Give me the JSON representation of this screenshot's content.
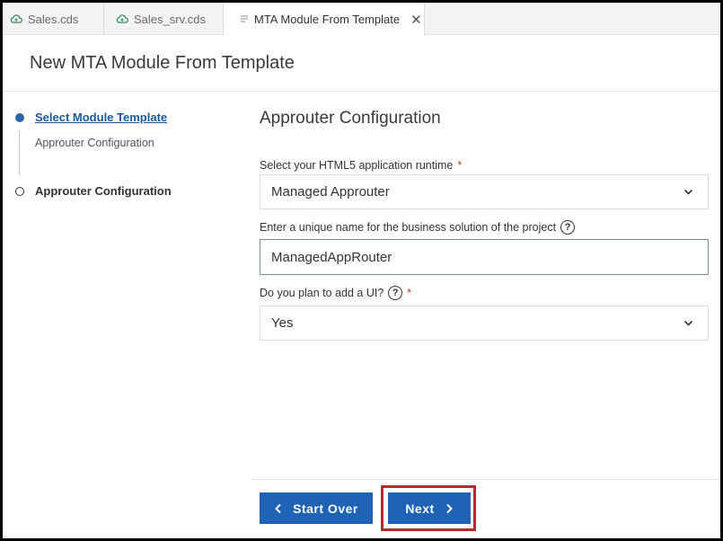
{
  "tabs": [
    {
      "label": "Sales.cds",
      "icon": "cloud-file-icon"
    },
    {
      "label": "Sales_srv.cds",
      "icon": "cloud-file-icon"
    },
    {
      "label": "MTA Module From Template",
      "icon": "document-icon",
      "active": true
    }
  ],
  "header": {
    "title": "New MTA Module From Template"
  },
  "wizard": {
    "step1": {
      "label": "Select Module Template",
      "sub": "Approuter Configuration"
    },
    "step2": {
      "label": "Approuter Configuration"
    }
  },
  "form": {
    "title": "Approuter Configuration",
    "runtime": {
      "label": "Select your HTML5 application runtime",
      "required": "*",
      "value": "Managed Approuter"
    },
    "business_name": {
      "label": "Enter a unique name for the business solution of the project",
      "value": "ManagedAppRouter"
    },
    "ui": {
      "label": "Do you plan to add a UI?",
      "required": "*",
      "value": "Yes"
    },
    "help_glyph": "?"
  },
  "footer": {
    "start_over": "Start Over",
    "next": "Next"
  },
  "colors": {
    "accent": "#1e63b5",
    "highlight": "#b52a2f",
    "link": "#1a5a9a"
  }
}
